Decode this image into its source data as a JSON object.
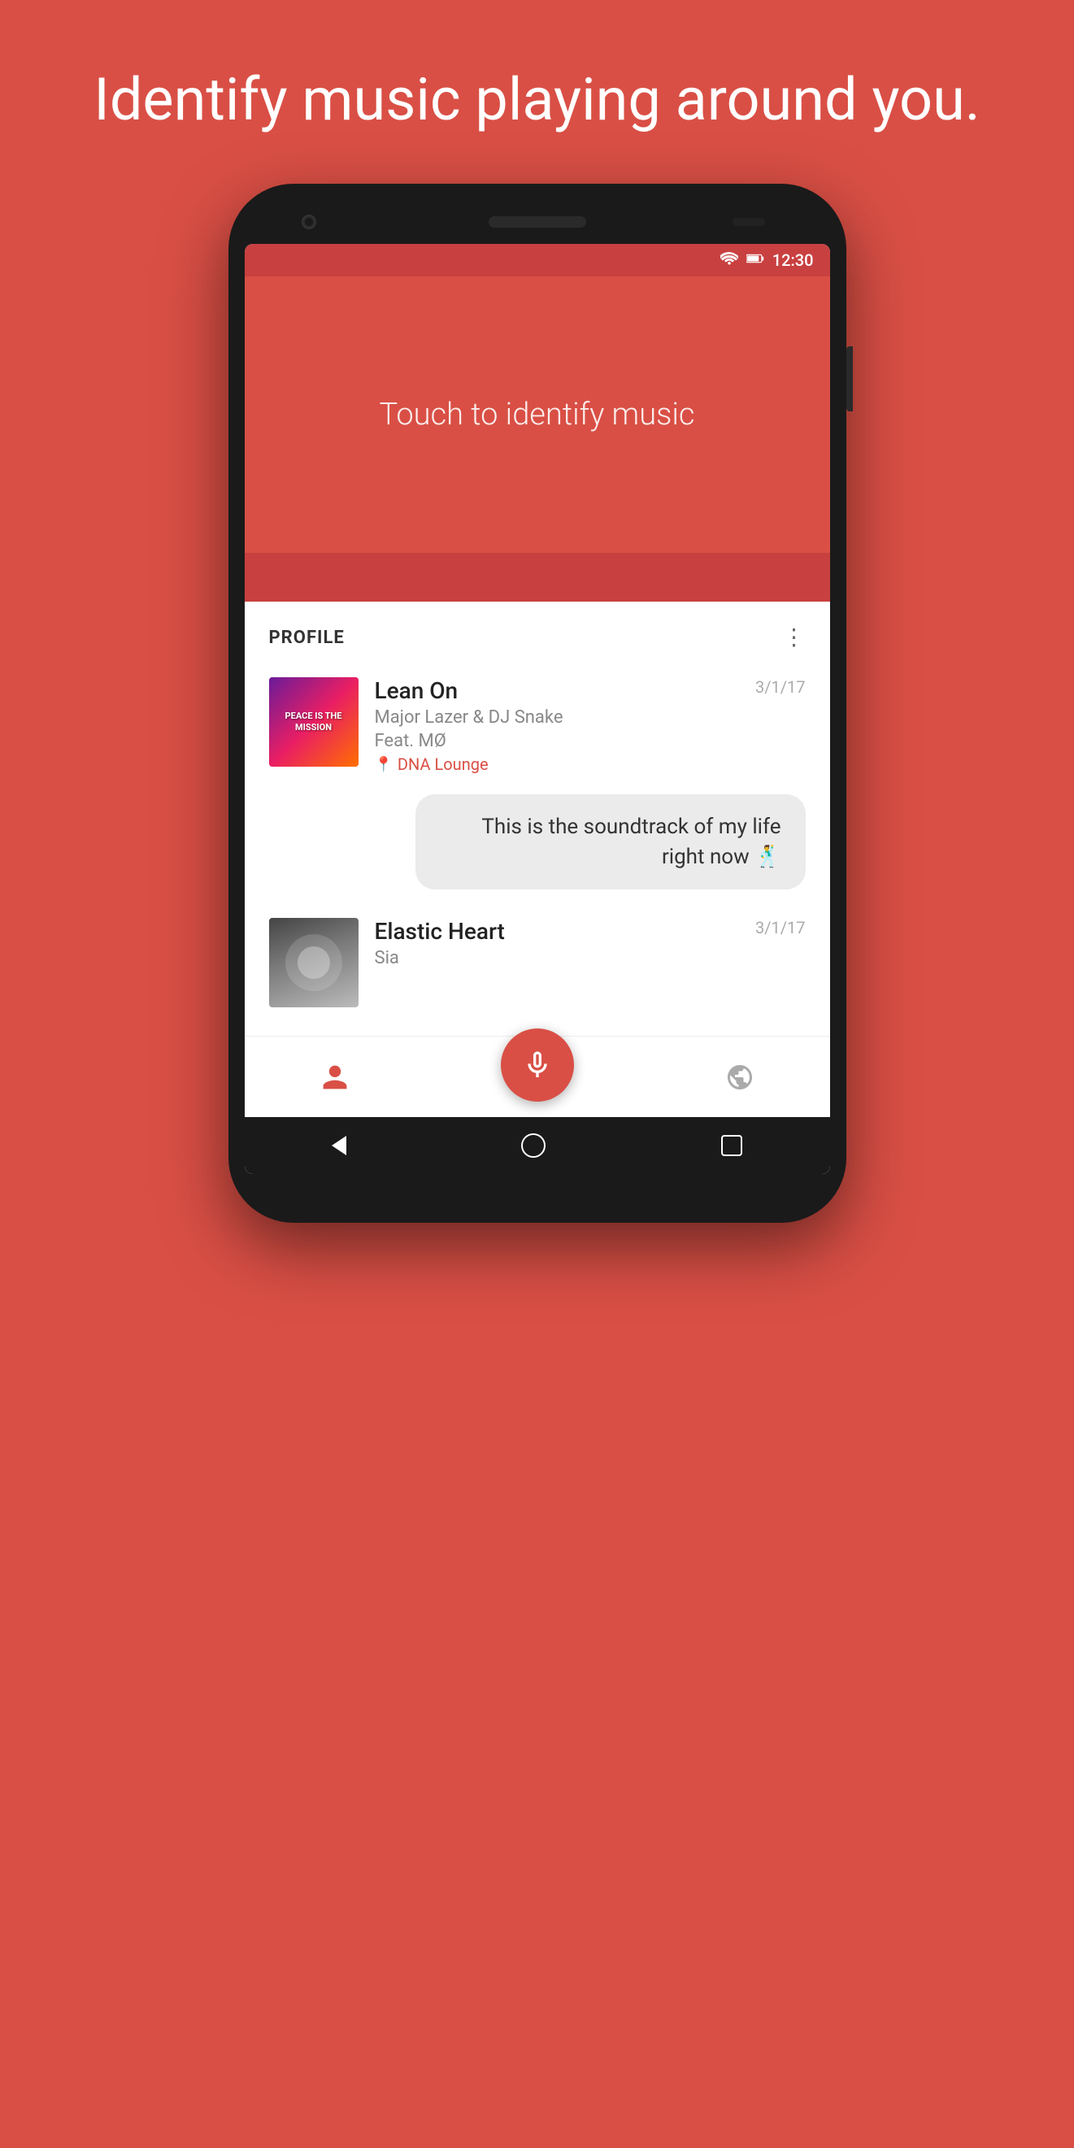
{
  "page": {
    "headline": "Identify music playing around you.",
    "background_color": "#d94f45"
  },
  "status_bar": {
    "time": "12:30",
    "wifi_icon": "wifi",
    "battery_icon": "battery"
  },
  "identify_section": {
    "prompt_text": "Touch to identify music"
  },
  "profile_section": {
    "label": "PROFILE",
    "more_icon": "more-vertical"
  },
  "songs": [
    {
      "title": "Lean On",
      "artist": "Major Lazer & DJ Snake",
      "artist_line2": "Feat. MØ",
      "location": "DNA Lounge",
      "date": "3/1/17",
      "album_art_type": "lean-on",
      "album_art_label": "PEACE IS THE MISSION"
    },
    {
      "title": "Elastic Heart",
      "artist": "Sia",
      "date": "3/1/17",
      "album_art_type": "elastic"
    }
  ],
  "message": {
    "text": "This is the soundtrack of my life right now 🕺"
  },
  "bottom_nav": {
    "profile_icon": "person",
    "mic_icon": "mic",
    "globe_icon": "globe"
  },
  "system_nav": {
    "back_label": "back",
    "home_label": "home",
    "recents_label": "recents"
  }
}
